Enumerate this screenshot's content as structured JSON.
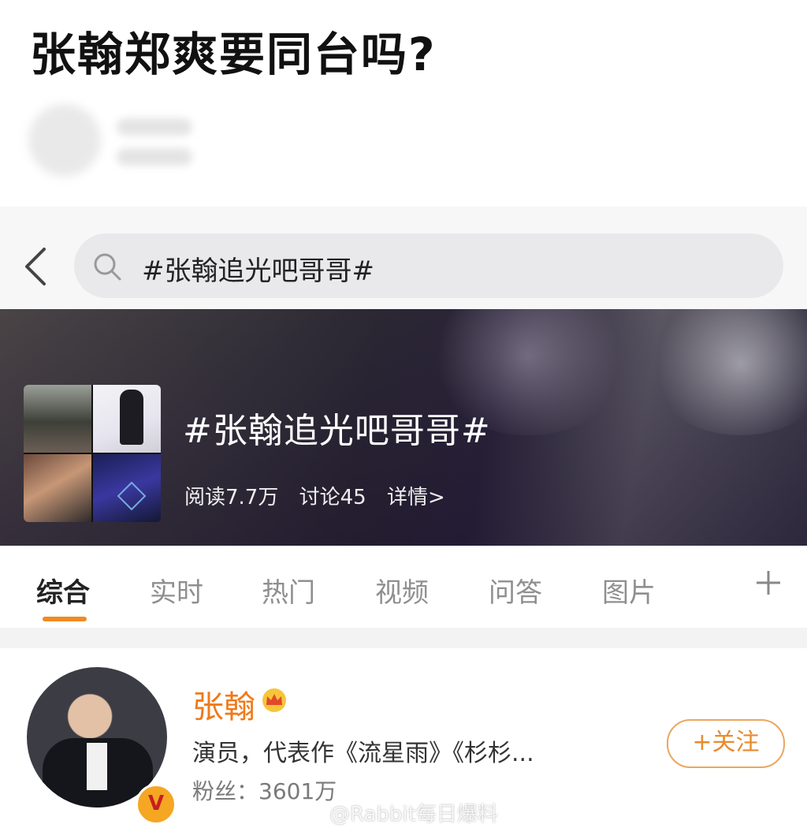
{
  "article": {
    "title": "张翰郑爽要同台吗?"
  },
  "search": {
    "query": "#张翰追光吧哥哥#"
  },
  "topic": {
    "title": "#张翰追光吧哥哥#",
    "reads": "阅读7.7万",
    "discussions": "讨论45",
    "details": "详情>"
  },
  "tabs": [
    {
      "label": "综合",
      "active": true
    },
    {
      "label": "实时"
    },
    {
      "label": "热门"
    },
    {
      "label": "视频"
    },
    {
      "label": "问答"
    },
    {
      "label": "图片"
    }
  ],
  "user": {
    "name": "张翰",
    "description": "演员，代表作《流星雨》《杉杉...",
    "fans": "粉丝：3601万",
    "follow_label": "+关注",
    "badge": "V"
  },
  "watermark": "@Rabbit每日爆料",
  "colors": {
    "accent": "#f08a22",
    "username": "#ef7a1a"
  }
}
